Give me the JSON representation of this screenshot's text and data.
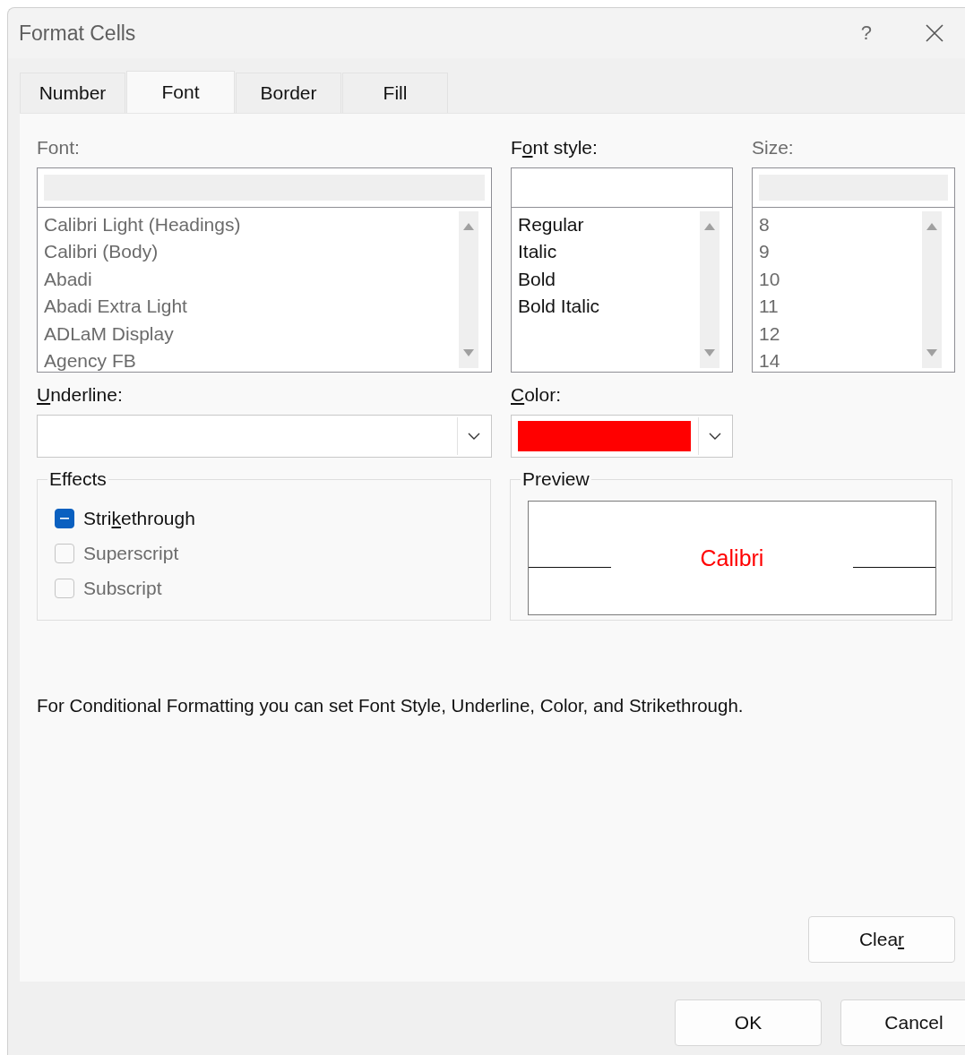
{
  "window": {
    "title": "Format Cells",
    "help": "?"
  },
  "tabs": [
    {
      "label": "Number",
      "selected": false
    },
    {
      "label": "Font",
      "selected": true
    },
    {
      "label": "Border",
      "selected": false
    },
    {
      "label": "Fill",
      "selected": false
    }
  ],
  "font": {
    "label": [
      {
        "text": "Font:"
      }
    ],
    "disabled": true,
    "items": [
      "Calibri Light (Headings)",
      "Calibri (Body)",
      "Abadi",
      "Abadi Extra Light",
      "ADLaM Display",
      "Agency FB"
    ]
  },
  "font_style": {
    "label": [
      {
        "text": "F"
      },
      {
        "text": "o",
        "underline": true
      },
      {
        "text": "nt style:"
      }
    ],
    "disabled": false,
    "items": [
      "Regular",
      "Italic",
      "Bold",
      "Bold Italic"
    ]
  },
  "size": {
    "label": [
      {
        "text": "Size:"
      }
    ],
    "disabled": true,
    "items": [
      "8",
      "9",
      "10",
      "11",
      "12",
      "14"
    ]
  },
  "underline": {
    "label": [
      {
        "text": "U",
        "underline": true
      },
      {
        "text": "nderline:"
      }
    ]
  },
  "color": {
    "label": [
      {
        "text": "C",
        "underline": true
      },
      {
        "text": "olor:"
      }
    ],
    "color": "#ff0000"
  },
  "effects": {
    "title": "Effects",
    "options": [
      {
        "label": [
          {
            "text": "Stri"
          },
          {
            "text": "k",
            "underline": true
          },
          {
            "text": "ethrough"
          }
        ],
        "indeterminate": true,
        "disabled": false
      },
      {
        "label": [
          {
            "text": "Superscript"
          }
        ],
        "indeterminate": false,
        "disabled": true
      },
      {
        "label": [
          {
            "text": "Subscript"
          }
        ],
        "indeterminate": false,
        "disabled": true
      }
    ]
  },
  "preview": {
    "title": "Preview",
    "sample": "Calibri"
  },
  "note": "For Conditional Formatting you can set Font Style, Underline, Color, and Strikethrough.",
  "clear_button": {
    "label": [
      {
        "text": "Clea"
      },
      {
        "text": "r",
        "underline": true
      }
    ]
  },
  "buttons": [
    "OK",
    "Cancel"
  ]
}
